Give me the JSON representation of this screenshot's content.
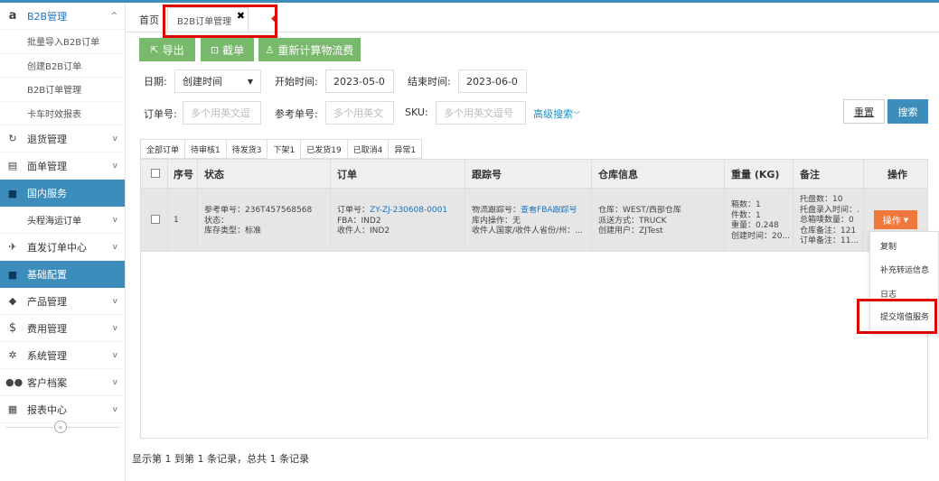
{
  "sidebar": {
    "items": [
      {
        "icon": "amazon-icon",
        "label": "B2B管理"
      },
      {
        "label": "批量导入B2B订单"
      },
      {
        "label": "创建B2B订单"
      },
      {
        "label": "B2B订单管理"
      },
      {
        "label": "卡车时效报表"
      },
      {
        "icon": "refresh-icon",
        "label": "退货管理"
      },
      {
        "icon": "document-icon",
        "label": "面单管理"
      },
      {
        "icon": "folder-icon",
        "label": "国内服务"
      },
      {
        "label": "头程海运订单"
      },
      {
        "icon": "plane-icon",
        "label": "直发订单中心"
      },
      {
        "icon": "folder-icon",
        "label": "基础配置"
      },
      {
        "icon": "tag-icon",
        "label": "产品管理"
      },
      {
        "icon": "dollar-icon",
        "label": "费用管理"
      },
      {
        "icon": "gear-icon",
        "label": "系统管理"
      },
      {
        "icon": "users-icon",
        "label": "客户档案"
      },
      {
        "icon": "table-icon",
        "label": "报表中心"
      }
    ],
    "collapse_label": "«",
    "chevron_up": "^",
    "chevron_down": "v"
  },
  "tabs": {
    "home": "首页",
    "active": "B2B订单管理",
    "close": "✖"
  },
  "toolbar": {
    "export": "导出",
    "cut": "截单",
    "recalc": "重新计算物流费"
  },
  "filters": {
    "date_label": "日期:",
    "date_type": "创建时间",
    "start_label": "开始时间:",
    "start_value": "2023-05-0",
    "end_label": "结束时间:",
    "end_value": "2023-06-0",
    "order_label": "订单号:",
    "order_placeholder": "多个用英文逗",
    "ref_label": "参考单号:",
    "ref_placeholder": "多个用英文",
    "sku_label": "SKU:",
    "sku_placeholder": "多个用英文逗号",
    "advanced": "高级搜索",
    "reset": "重置",
    "search": "搜索"
  },
  "status_tabs": [
    "全部订单",
    "待审核1",
    "待发货3",
    "下架1",
    "已发货19",
    "已取消4",
    "异常1"
  ],
  "table": {
    "headers": [
      "序号",
      "状态",
      "订单",
      "跟踪号",
      "仓库信息",
      "重量 (KG)",
      "备注",
      "操作"
    ],
    "row": {
      "index": "1",
      "status": [
        "参考单号：236T457568568",
        "状态：",
        "库存类型：标准"
      ],
      "order": {
        "no_label": "订单号：",
        "no_value": "ZY-ZJ-230608-0001",
        "fba": "FBA：IND2",
        "receiver": "收件人：IND2"
      },
      "tracking": {
        "label": "物流跟踪号：",
        "link": "查看FBA跟踪号",
        "op": "库内操作：无",
        "addr": "收件人国家/收件人省份/州：..."
      },
      "warehouse": [
        "仓库：WEST/西部仓库",
        "派送方式：TRUCK",
        "创建用户：ZJTest"
      ],
      "weight": [
        "箱数：1",
        "件数：1",
        "重量：0.248",
        "创建时间：20..."
      ],
      "remark": [
        "托盘数：10",
        "托盘录入时间：.",
        "总箱唛数量：0",
        "仓库备注：121",
        "订单备注：11..."
      ]
    }
  },
  "op_button": "操作",
  "op_menu": [
    "复制",
    "补充转运信息",
    "日志",
    "提交增值服务"
  ],
  "footer": "显示第 1 到第 1 条记录，总共 1 条记录",
  "colors": {
    "accent": "#3c8dbc",
    "green": "#79b96b",
    "orange": "#f0783c",
    "highlight": "#e00000"
  }
}
